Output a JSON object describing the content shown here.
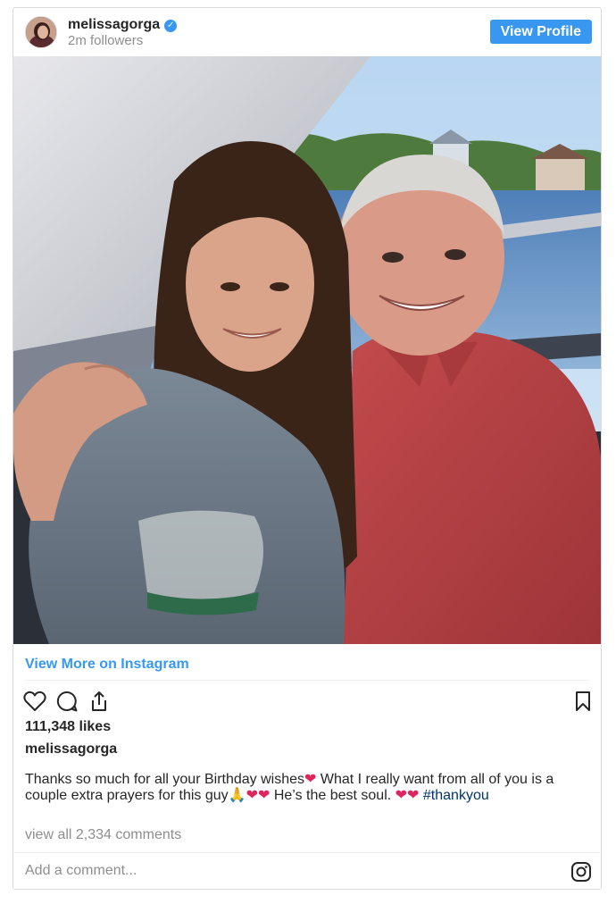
{
  "header": {
    "username": "melissagorga",
    "followers": "2m followers",
    "view_profile_label": "View Profile"
  },
  "post": {
    "view_more_label": "View More on Instagram",
    "likes": "111,348 likes",
    "author": "melissagorga",
    "caption_text_1": "Thanks so much for all your Birthday wishes",
    "caption_text_2": " What I really want from all of you is a couple extra prayers for this guy",
    "caption_text_3": " He’s the best soul. ",
    "hashtag": "#thankyou",
    "view_comments": "view all 2,334 comments"
  },
  "comment_box": {
    "placeholder": "Add a comment..."
  },
  "colors": {
    "accent": "#3897f0",
    "heart": "#e0245e",
    "muted": "#8e8e8e",
    "text": "#262626"
  },
  "icons": [
    "verified-badge-icon",
    "heart-icon",
    "comment-icon",
    "share-icon",
    "bookmark-icon",
    "instagram-icon"
  ]
}
